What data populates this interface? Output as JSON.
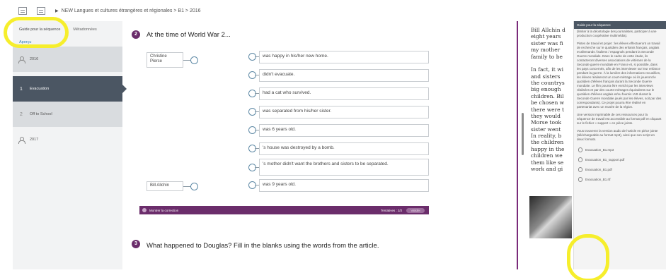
{
  "breadcrumb": "NEW Langues et cultures étrangères et régionales > B1 > 2016",
  "sidebar": {
    "tabs": [
      "Guide pour la séquence",
      "Métadonnées"
    ],
    "apercu": "Aperçu",
    "items": [
      {
        "num": "",
        "label": "2016"
      },
      {
        "num": "1",
        "label": "Evacuation"
      },
      {
        "num": "2",
        "label": "Off to School"
      },
      {
        "num": "",
        "label": "2017"
      }
    ]
  },
  "question2": {
    "number": "2",
    "title": "At the time of World War 2...",
    "left_items": [
      "Christine Pierce",
      "Bill Allchin"
    ],
    "right_items": [
      "was happy in his/her new home.",
      "didn't evacuate.",
      "had a cat who survived.",
      "was separated from his/her sister.",
      "was 6 years old.",
      "'s house was destroyed by a bomb.",
      "'s mother didn't want the brothers and sisters to be separated.",
      "was 9 years old."
    ]
  },
  "correction_bar": {
    "show_correction": "Montrer la correction",
    "attempts": "Tentatives : 2/2",
    "validate": "Valider"
  },
  "question3": {
    "number": "3",
    "title": "What happened to Douglas? Fill in the blanks using the words from the article."
  },
  "reading_text": "Bill Allchin d\neight years\nsister was fi\nmy mother\nfamily to be\n\nIn fact, it wi\nand sisters \nthe countrys\nbig enough\nchildren. Bil\nbe chosen w\nthere were t\nthey would \nMorse took \nsister went \nIn reality, b\nthe children\nhappy in the\nchildren we\nthem like se\nwork and gi",
  "guide": {
    "header": "Guide pour la séquence",
    "paragraphs": [
      "(limiter à la déontologie des journalistes, participer à une production coopérative multimédia).",
      "Pistes de travail et projet : les élèves effectueront un travail de recherche sur le quotidien des enfants français, anglais et allemands / italiens / espagnols pendant la Seconde Guerre mondiale. Dans le cadre de cette étude, ils contacteront diverses associations de vétérans de la Seconde guerre mondiale en France et, si possible, dans les pays concernés, afin de les interviewer sur leur enfance pendant la guerre. À la lumière des informations recueillies, les élèves réaliseront un court-métrage où ils joueront le quotidien d'élèves français durant la Seconde Guerre mondiale. Le film pourra être enrichi par les interviews réalisées et par des courts-métrages équivalents sur le quotidien d'élèves anglais et/ou fournis LV8 durant la Seconde Guerre mondiale joués par les élèves, soit par des correspondants). Ce projet pourra être réalisé en partenariat avec un musée de la région.",
      "Une version imprimable de ces ressources pour la séquence de travail est accessible au format pdf en cliquant sur le fichier « support » en pièce jointe.",
      "Vous trouverez la version audio de l'article en pièce jointe (téléchargeable au format mp3), ainsi que son script en deux formats."
    ],
    "files": [
      "Evacuation_B1.mp3",
      "Evacuation_B1_support.pdf",
      "Evacuation_B1.pdf",
      "Evacuation_B1.rtf"
    ]
  }
}
